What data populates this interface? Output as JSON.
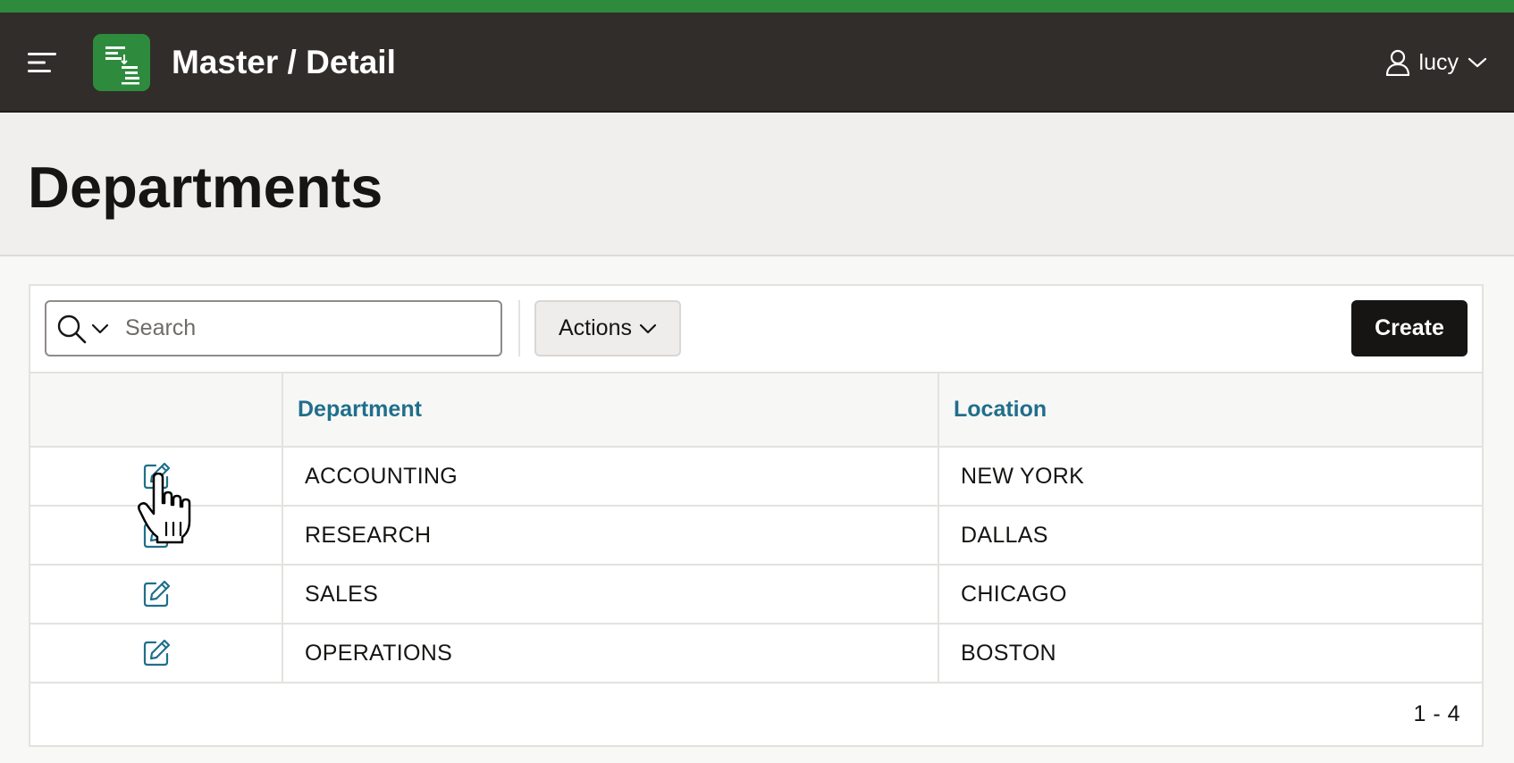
{
  "header": {
    "app_title": "Master / Detail",
    "user_name": "lucy",
    "accent_color": "#2e8b3e",
    "background_color": "#312d2a",
    "menu_icon": "hamburger-menu-icon",
    "logo_icon": "master-detail-app-icon",
    "user_icon": "user-icon"
  },
  "page": {
    "title": "Departments"
  },
  "toolbar": {
    "search_placeholder": "Search",
    "search_value": "",
    "actions_label": "Actions",
    "create_label": "Create"
  },
  "table": {
    "columns": [
      "",
      "Department",
      "Location"
    ],
    "rows": [
      {
        "department": "ACCOUNTING",
        "location": "NEW YORK"
      },
      {
        "department": "RESEARCH",
        "location": "DALLAS"
      },
      {
        "department": "SALES",
        "location": "CHICAGO"
      },
      {
        "department": "OPERATIONS",
        "location": "BOSTON"
      }
    ],
    "edit_icon": "edit-icon",
    "header_link_color": "#1f6f8b"
  },
  "pagination": {
    "range": "1 - 4"
  }
}
